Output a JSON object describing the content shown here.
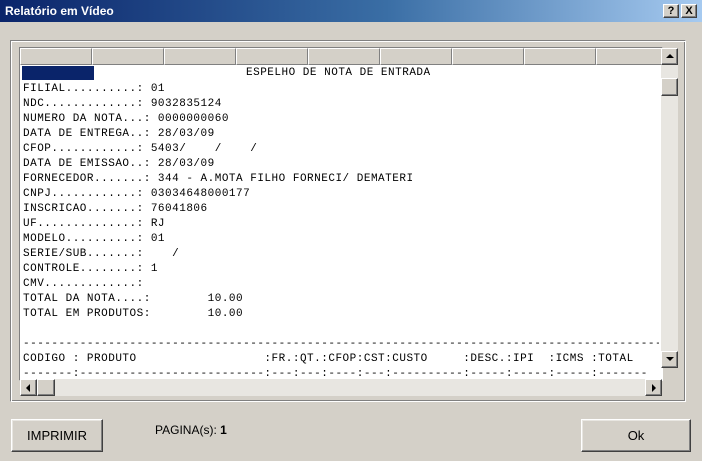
{
  "window": {
    "title": "Relatório em Vídeo",
    "help_label": "?",
    "close_label": "X"
  },
  "report": {
    "heading": "ESPELHO DE NOTA DE ENTRADA",
    "lines": [
      "FILIAL..........: 01",
      "NDC.............: 9032835124",
      "NUMERO DA NOTA...: 0000000060",
      "DATA DE ENTREGA..: 28/03/09",
      "CFOP............: 5403/    /    /",
      "DATA DE EMISSAO..: 28/03/09",
      "FORNECEDOR.......: 344 - A.MOTA FILHO FORNECI/ DEMATERI",
      "CNPJ............: 03034648000177",
      "INSCRICAO.......: 76041806",
      "UF..............: RJ",
      "MODELO..........: 01",
      "SERIE/SUB.......:    /",
      "CONTROLE........: 1",
      "CMV.............: ",
      "TOTAL DA NOTA....:        10.00",
      "TOTAL EM PRODUTOS:        10.00",
      "",
      "------------------------------------------------------------------------------------------",
      "CODIGO : PRODUTO                  :FR.:QT.:CFOP:CST:CUSTO     :DESC.:IPI  :ICMS :TOTAL",
      "-------:--------------------------:---:---:----:---:----------:-----:-----:-----:-------"
    ]
  },
  "footer": {
    "print_label": "IMPRIMIR",
    "ok_label": "Ok",
    "page_label": "PAGINA(s):",
    "page_value": "1"
  }
}
